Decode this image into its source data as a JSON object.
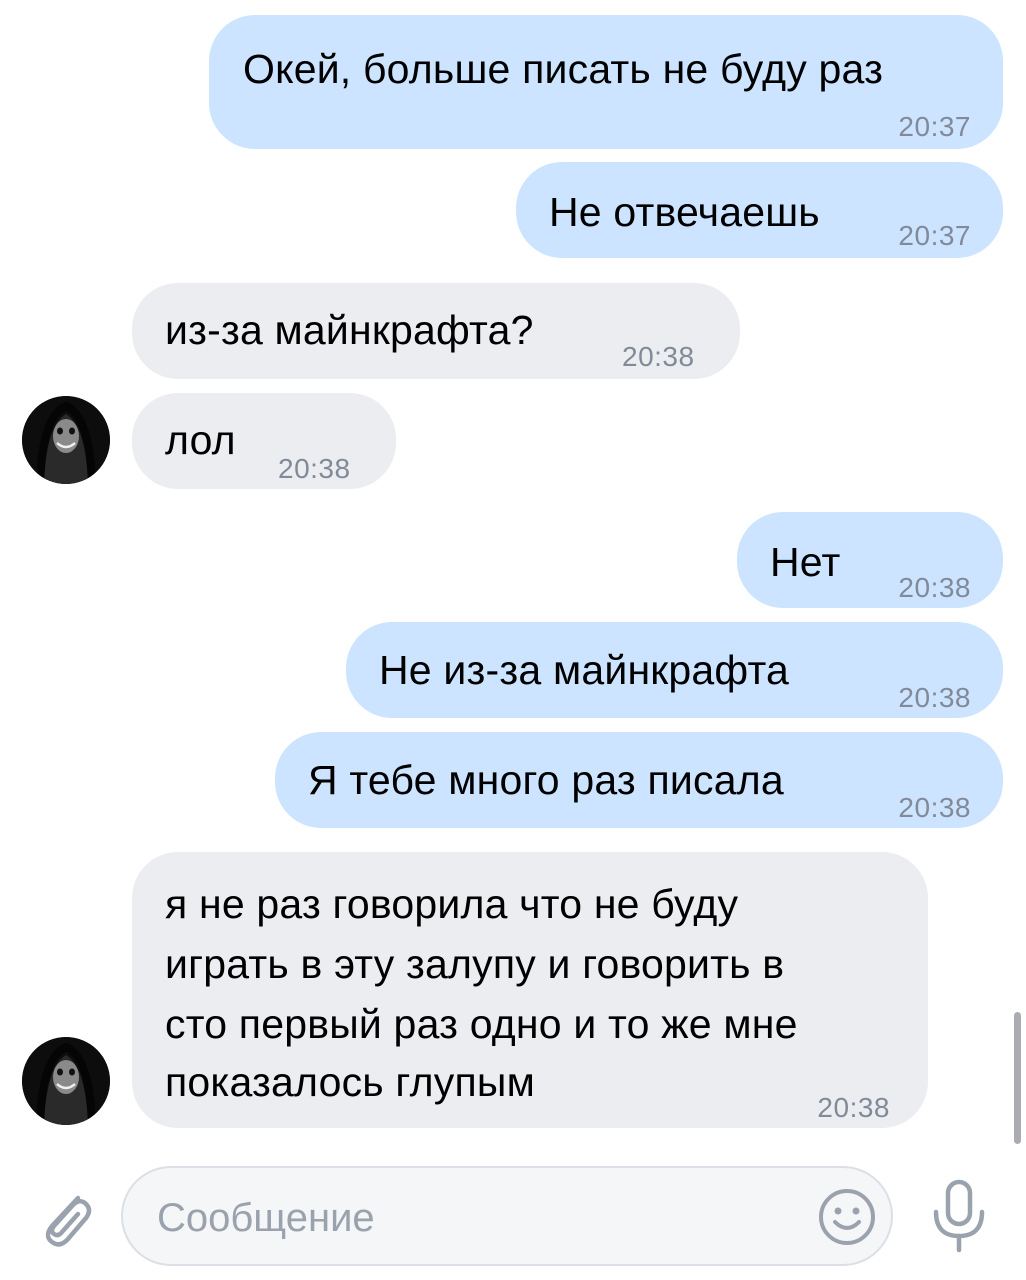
{
  "messages": [
    {
      "dir": "out",
      "text": "Окей, больше писать не буду раз",
      "time": "20:37"
    },
    {
      "dir": "out",
      "text": "Не отвечаешь",
      "time": "20:37"
    },
    {
      "dir": "in",
      "text": "из-за майнкрафта?",
      "time": "20:38"
    },
    {
      "dir": "in",
      "text": "лол",
      "time": "20:38"
    },
    {
      "dir": "out",
      "text": "Нет",
      "time": "20:38"
    },
    {
      "dir": "out",
      "text": "Не из-за майнкрафта",
      "time": "20:38"
    },
    {
      "dir": "out",
      "text": "Я тебе много раз писала",
      "time": "20:38"
    },
    {
      "dir": "in",
      "lines": [
        "я не раз говорила что не буду",
        "играть в эту залупу и говорить в",
        "сто первый раз одно и то же мне",
        "показалось глупым"
      ],
      "time": "20:38"
    }
  ],
  "composer": {
    "placeholder": "Сообщение",
    "attach_icon": "paperclip-icon",
    "emoji_icon": "smile-icon",
    "mic_icon": "microphone-icon"
  },
  "colors": {
    "outgoing_bubble": "#cce4ff",
    "incoming_bubble": "#ebedf0",
    "timestamp": "#828a99",
    "icon": "#99a2ad"
  }
}
